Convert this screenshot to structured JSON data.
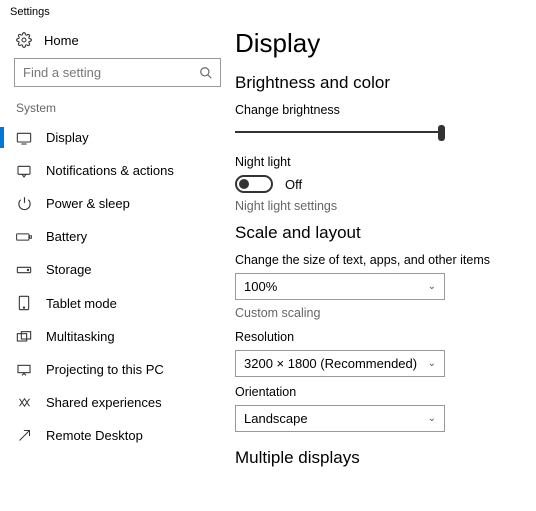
{
  "titlebar": "Settings",
  "home_label": "Home",
  "search": {
    "placeholder": "Find a setting"
  },
  "sidebar": {
    "section": "System",
    "items": [
      {
        "label": "Display"
      },
      {
        "label": "Notifications & actions"
      },
      {
        "label": "Power & sleep"
      },
      {
        "label": "Battery"
      },
      {
        "label": "Storage"
      },
      {
        "label": "Tablet mode"
      },
      {
        "label": "Multitasking"
      },
      {
        "label": "Projecting to this PC"
      },
      {
        "label": "Shared experiences"
      },
      {
        "label": "Remote Desktop"
      }
    ]
  },
  "page": {
    "title": "Display",
    "brightness": {
      "group": "Brightness and color",
      "change_label": "Change brightness",
      "night_label": "Night light",
      "toggle_state": "Off",
      "settings_link": "Night light settings"
    },
    "scale": {
      "group": "Scale and layout",
      "size_label": "Change the size of text, apps, and other items",
      "size_value": "100%",
      "custom_link": "Custom scaling",
      "res_label": "Resolution",
      "res_value": "3200 × 1800 (Recommended)",
      "orient_label": "Orientation",
      "orient_value": "Landscape"
    },
    "multiple": {
      "group": "Multiple displays"
    }
  }
}
